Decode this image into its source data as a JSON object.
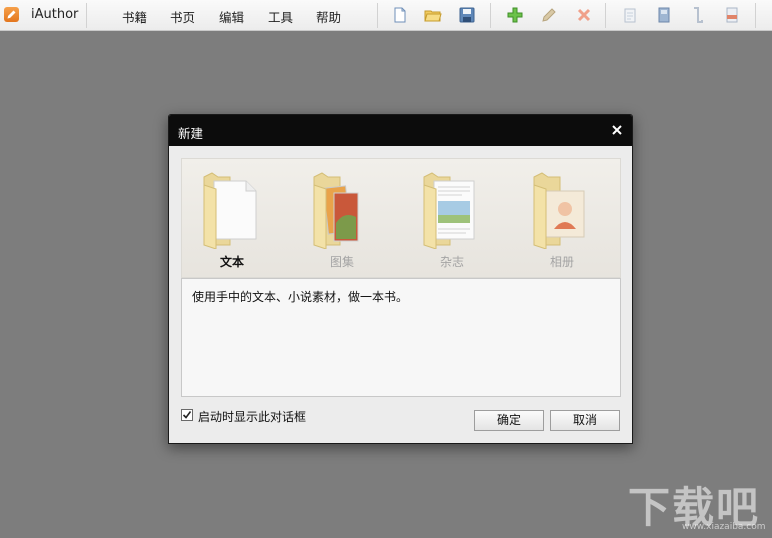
{
  "app": {
    "name": "iAuthor",
    "logo_icon": "pencil-icon",
    "accent": "#e8832a"
  },
  "menu": {
    "items": [
      {
        "label": "书籍"
      },
      {
        "label": "书页"
      },
      {
        "label": "编辑"
      },
      {
        "label": "工具"
      },
      {
        "label": "帮助"
      }
    ]
  },
  "toolbar": {
    "icons": [
      "new-file-icon",
      "open-folder-icon",
      "save-icon",
      "add-icon",
      "edit-icon",
      "delete-icon",
      "page-icon",
      "book-icon",
      "bookmark-icon",
      "export-icon"
    ]
  },
  "dialog": {
    "title": "新建",
    "templates": [
      {
        "label": "文本",
        "selected": true,
        "icon": "text-folder-icon"
      },
      {
        "label": "图集",
        "selected": false,
        "icon": "gallery-folder-icon"
      },
      {
        "label": "杂志",
        "selected": false,
        "icon": "magazine-folder-icon"
      },
      {
        "label": "相册",
        "selected": false,
        "icon": "album-folder-icon"
      }
    ],
    "description": "使用手中的文本、小说素材，做一本书。",
    "show_on_startup": {
      "label": "启动时显示此对话框",
      "checked": true
    },
    "ok_label": "确定",
    "cancel_label": "取消"
  },
  "watermark": {
    "text": "下载吧",
    "url": "www.xiazaiba.com"
  }
}
